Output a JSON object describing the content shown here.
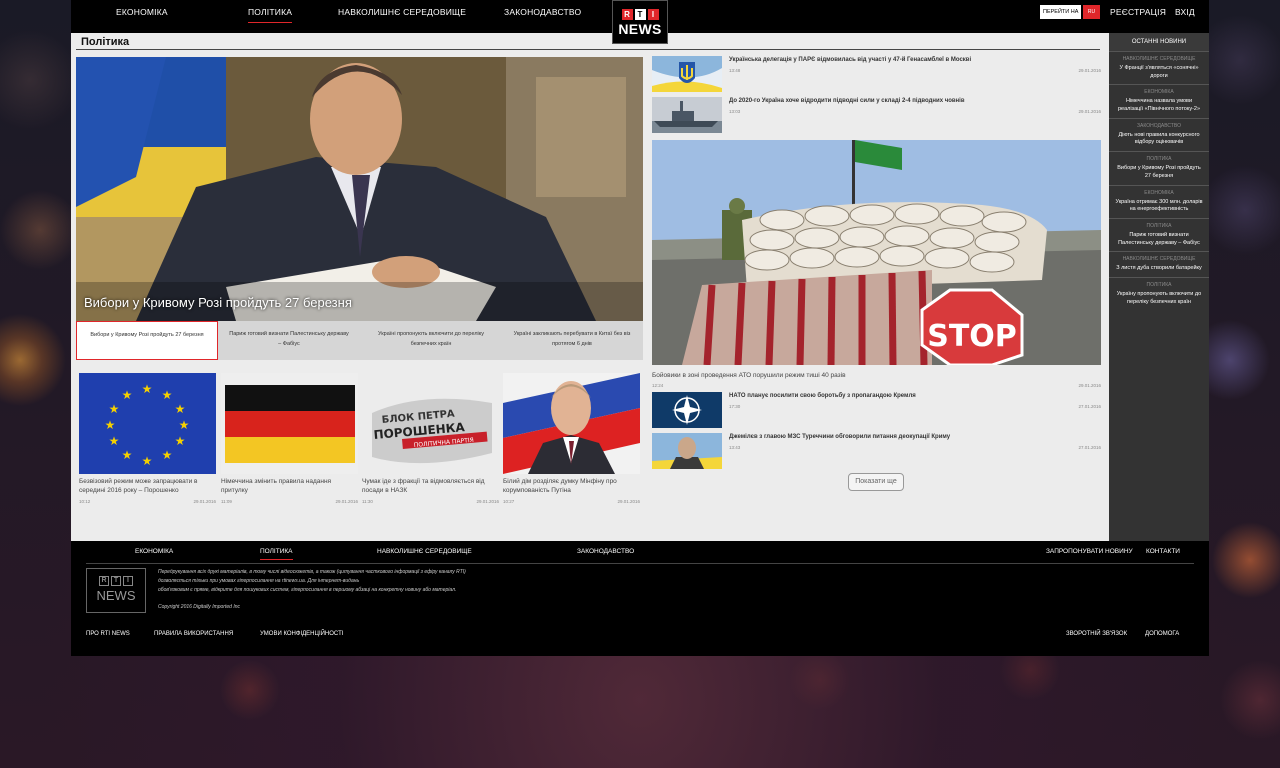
{
  "nav": {
    "items": [
      "Економіка",
      "Політика",
      "Навколишнє середовище",
      "Законодавство"
    ],
    "logo_letters": [
      "R",
      "T",
      "I"
    ],
    "logo_word": "NEWS",
    "goto_label": "Перейти на",
    "goto_lang": "RU",
    "register": "Реєстрація",
    "login": "Вхід"
  },
  "section": {
    "title": "Політика"
  },
  "hero": {
    "caption": "Вибори у Кривому Розі пройдуть 27 березня",
    "strip": [
      "Вибори у Кривому Розі пройдуть 27 березня",
      "Париж готовий визнати Палестинську державу – Фабіус",
      "Україні пропонують включити до переліку безпечних країн",
      "Україні закликають перебувати в Китаї без віз протягом 6 днів"
    ]
  },
  "cards": [
    {
      "title": "Безвізовий режим може запрацювати в середині 2016 року – Порошенко",
      "time": "10:12",
      "date": "29.01.2016"
    },
    {
      "title": "Німеччина змінить правила надання притулку",
      "time": "11:09",
      "date": "29.01.2016"
    },
    {
      "title": "Чумак іде з фракції та відмовляється від посади в НАЗК",
      "time": "11:30",
      "date": "29.01.2016"
    },
    {
      "title": "Білий дім розділяє думку Мінфіну про корумпованість Путіна",
      "time": "10:27",
      "date": "29.01.2016"
    }
  ],
  "right_top": [
    {
      "title": "Українська делегація у ПАРЄ відмовилась від участі у 47-й Генасамблеї в Москві",
      "time": "13:48",
      "date": "29.01.2016"
    },
    {
      "title": "До 2020-го Україна хоче відродити підводні сили у складі 2-4 підводних човнів",
      "time": "13:03",
      "date": "29.01.2016"
    }
  ],
  "big": {
    "caption": "Бойовики в зоні проведення АТО порушили режим тиші 40 разів",
    "time": "12:24",
    "date": "29.01.2016",
    "stop": "STOP"
  },
  "right_bottom": [
    {
      "title": "НАТО планує посилити свою боротьбу з пропагандою Кремля",
      "time": "17:30",
      "date": "27.01.2016"
    },
    {
      "title": "Джемілєв з главою МЗС Туреччини обговорили питання деокупації Криму",
      "time": "13:43",
      "date": "27.01.2016"
    }
  ],
  "more_label": "Показати ще",
  "card_text": {
    "party_line1": "БЛОК ПЕТРА",
    "party_line2": "ПОРОШЕНКА",
    "party_line3": "ПОЛІТИЧНА ПАРТІЯ"
  },
  "sidebar": {
    "head": "Останні новини",
    "items": [
      {
        "cat": "Навколишнє середовище",
        "title": "У Франції з'являться «сонячні» дороги"
      },
      {
        "cat": "Економіка",
        "title": "Німеччина назвала умови реалізації «Північного потоку-2»"
      },
      {
        "cat": "Законодавство",
        "title": "Діють нові правила конкурсного відбору оцінювачів"
      },
      {
        "cat": "Політика",
        "title": "Вибори у Кривому Розі пройдуть 27 березня"
      },
      {
        "cat": "Економіка",
        "title": "Україна отримає 300 млн. доларів на енергоефективність"
      },
      {
        "cat": "Політика",
        "title": "Париж готовий визнати Палестинську державу – Фабіус"
      },
      {
        "cat": "Навколишнє середовище",
        "title": "З листя дуба створили батарейку"
      },
      {
        "cat": "Політика",
        "title": "Україну пропонують включити до переліку безпечних країн"
      }
    ]
  },
  "footer": {
    "nav": [
      "Економіка",
      "Політика",
      "Навколишнє середовище",
      "Законодавство"
    ],
    "suggest": "Запропонувати новину",
    "contacts": "Контакти",
    "text1": "Передрукування всіх друкі матеріалів, в тому числі відеосюжетів, а також (цитування часткового інформації з ефіру каналу RTI)",
    "text2": "дозволяється тільки при умовах гіперпосилання на rtinews.ua. Для інтернет-видань",
    "text3": "обов'язковим є пряме, відкрите для пошукових систем, гіперпосилання в першому абзаці на конкретну новину або матеріал.",
    "copyright": "Copyright 2016 Digitally Imported Inc",
    "about": "Про RTI News",
    "rules": "Правила використання",
    "privacy": "Умови конфіденційності",
    "feedback": "Зворотній зв'язок",
    "help": "Допомога"
  },
  "colors": {
    "accent": "#e0262a",
    "topbar": "#000000",
    "sidebar": "#333333",
    "page": "#ececec"
  }
}
